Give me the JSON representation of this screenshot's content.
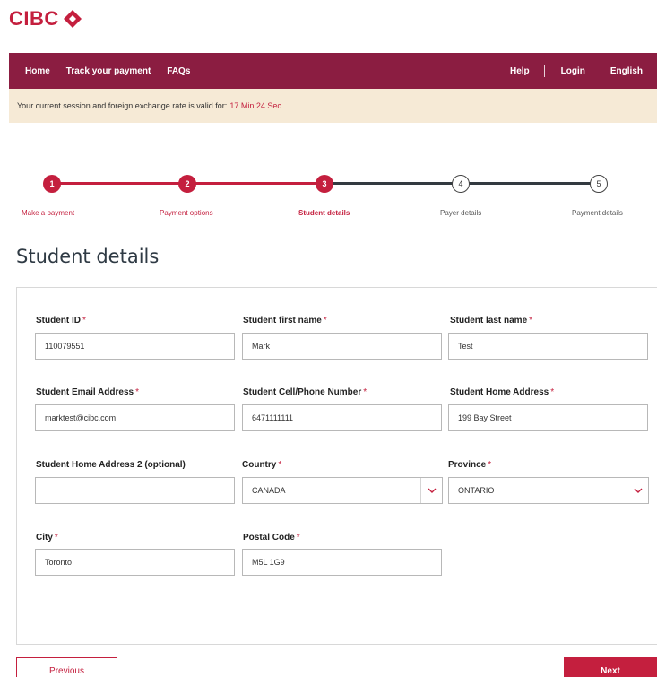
{
  "brand": {
    "name": "CIBC",
    "color": "#c41f3e",
    "logo_icon": "cibc-diamond-logo"
  },
  "nav": {
    "items": [
      "Home",
      "Track your payment",
      "FAQs"
    ],
    "help": "Help",
    "login": "Login",
    "language": "English",
    "background": "#8b1d41"
  },
  "session": {
    "text": "Your current session and foreign exchange rate is valid for:",
    "time": "17 Min:24 Sec"
  },
  "stepper": {
    "current_step": 3,
    "steps": [
      {
        "number": "1",
        "label": "Make a payment",
        "state": "done"
      },
      {
        "number": "2",
        "label": "Payment options",
        "state": "done"
      },
      {
        "number": "3",
        "label": "Student details",
        "state": "active"
      },
      {
        "number": "4",
        "label": "Payer details",
        "state": "todo"
      },
      {
        "number": "5",
        "label": "Payment details",
        "state": "todo"
      }
    ]
  },
  "page_title": "Student details",
  "form": {
    "student_id": {
      "label": "Student ID",
      "required_mark": "*",
      "value": "110079551"
    },
    "first_name": {
      "label": "Student first name",
      "required_mark": "*",
      "value": "Mark"
    },
    "last_name": {
      "label": "Student last name",
      "required_mark": "*",
      "value": "Test"
    },
    "email": {
      "label": "Student Email Address",
      "required_mark": "*",
      "value": "marktest@cibc.com"
    },
    "phone": {
      "label": "Student Cell/Phone Number",
      "required_mark": "*",
      "value": "6471111111"
    },
    "address": {
      "label": "Student Home Address",
      "required_mark": "*",
      "value": "199 Bay Street"
    },
    "address2": {
      "label": "Student Home Address 2 (optional)",
      "value": ""
    },
    "country": {
      "label": "Country",
      "required_mark": "*",
      "value": "CANADA"
    },
    "province": {
      "label": "Province",
      "required_mark": "*",
      "value": "ONTARIO"
    },
    "city": {
      "label": "City",
      "required_mark": "*",
      "value": "Toronto"
    },
    "postal_code": {
      "label": "Postal Code",
      "required_mark": "*",
      "value": "M5L 1G9"
    }
  },
  "buttons": {
    "previous": "Previous",
    "next": "Next"
  }
}
